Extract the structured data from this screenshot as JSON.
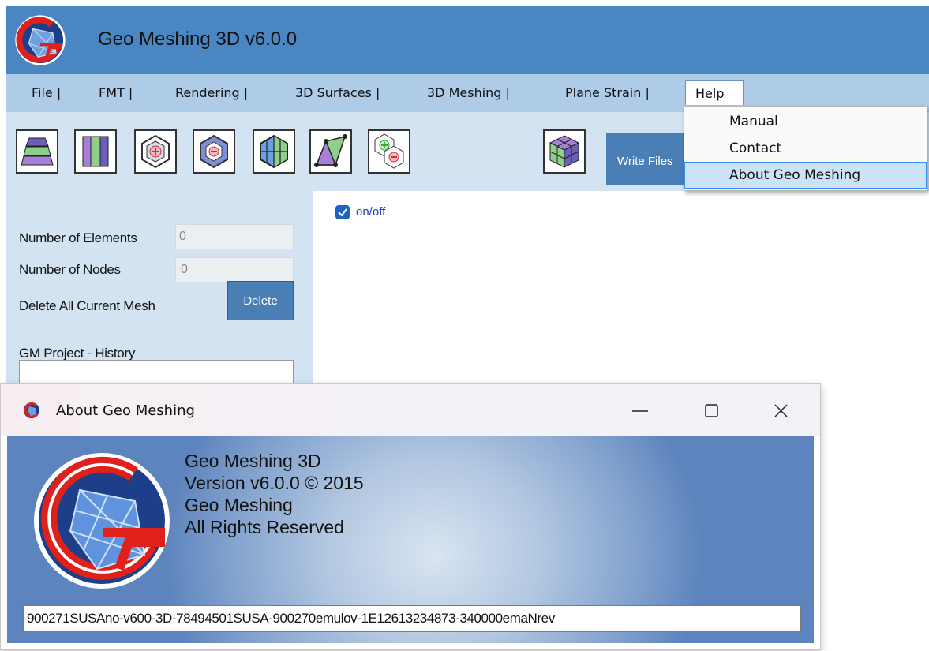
{
  "app": {
    "title": "Geo Meshing 3D v6.0.0"
  },
  "menu": {
    "items": [
      {
        "label": "File |"
      },
      {
        "label": "FMT |"
      },
      {
        "label": "Rendering |"
      },
      {
        "label": "3D Surfaces |"
      },
      {
        "label": "3D Meshing |"
      },
      {
        "label": "Plane Strain |"
      }
    ],
    "help_label": "Help"
  },
  "help_menu": {
    "items": [
      {
        "label": "Manual"
      },
      {
        "label": "Contact"
      },
      {
        "label": "About Geo Meshing"
      }
    ],
    "highlighted": "About Geo Meshing"
  },
  "toolbar": {
    "tools": [
      "layers-icon",
      "vertical-layers-icon",
      "hexagon-add-icon",
      "hexagon-remove-icon",
      "mesh-polygon-icon",
      "triangle-quad-icon",
      "add-remove-icon",
      "cube-icon"
    ],
    "write_files_label": "Write Files"
  },
  "left_panel": {
    "elements_label": "Number of Elements",
    "elements_value": "0",
    "nodes_label": "Number of Nodes",
    "nodes_value": "0",
    "delete_label": "Delete All Current Mesh",
    "delete_button": "Delete",
    "history_label": "GM Project - History"
  },
  "viewport": {
    "checkbox_label": "on/off",
    "checked": true
  },
  "about": {
    "title": "About Geo Meshing",
    "line1": "Geo Meshing 3D",
    "line2": "Version v6.0.0 © 2015",
    "line3": "Geo Meshing",
    "line4": "All Rights Reserved",
    "license": "900271SUSAno-v600-3D-78494501SUSA-900270emulov-1E12613234873-340000emaNrev"
  },
  "colors": {
    "title_bar": "#4a86c2",
    "menu_bar": "#aecbe7",
    "panel": "#d3e3f2",
    "button": "#4a7fb5",
    "menu_highlight": "#cce3f7"
  }
}
